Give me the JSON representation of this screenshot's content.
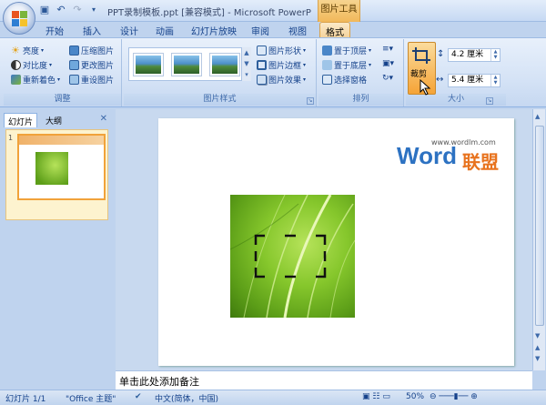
{
  "window": {
    "title": "PPT录制模板.ppt [兼容模式] - Microsoft PowerP",
    "context_tool": "图片工具"
  },
  "qat": {
    "save_icon": "save-icon",
    "undo_icon": "undo-icon",
    "redo_icon": "redo-icon",
    "more_icon": "chevron-down-icon"
  },
  "tabs": [
    "开始",
    "插入",
    "设计",
    "动画",
    "幻灯片放映",
    "审阅",
    "视图",
    "格式"
  ],
  "ribbon": {
    "adjust": {
      "label": "调整",
      "brightness": "亮度",
      "contrast": "对比度",
      "recolor": "重新着色",
      "compress": "压缩图片",
      "change": "更改图片",
      "reset": "重设图片"
    },
    "styles": {
      "label": "图片样式",
      "shape": "图片形状",
      "border": "图片边框",
      "effects": "图片效果"
    },
    "arrange": {
      "label": "排列",
      "front": "置于顶层",
      "back": "置于底层",
      "pane": "选择窗格"
    },
    "size": {
      "label": "大小",
      "crop": "裁剪",
      "height": "4.2 厘米",
      "width": "5.4 厘米"
    }
  },
  "left_pane": {
    "tab_slides": "幻灯片",
    "tab_outline": "大纲",
    "close": "✕",
    "slide_number": "1"
  },
  "watermark": {
    "url": "www.wordlm.com",
    "word": "Word",
    "lianmeng": "联盟"
  },
  "notes": {
    "placeholder": "单击此处添加备注"
  },
  "status": {
    "slide": "幻灯片 1/1",
    "theme": "\"Office 主题\"",
    "language": "中文(简体，中国)",
    "zoom": "50%"
  },
  "colors": {
    "accent": "#f4d29b",
    "ribbon": "#d5e3f6",
    "brand": "#2d72c2"
  }
}
